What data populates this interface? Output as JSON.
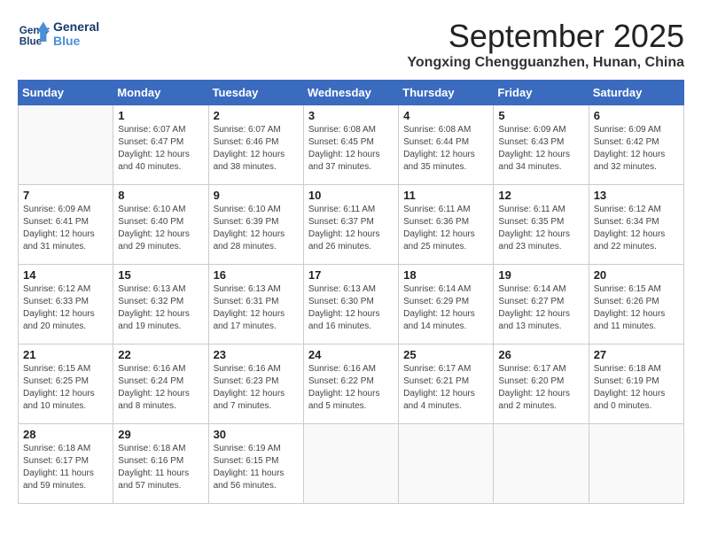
{
  "header": {
    "logo_line1": "General",
    "logo_line2": "Blue",
    "month": "September 2025",
    "location": "Yongxing Chengguanzhen, Hunan, China"
  },
  "weekdays": [
    "Sunday",
    "Monday",
    "Tuesday",
    "Wednesday",
    "Thursday",
    "Friday",
    "Saturday"
  ],
  "weeks": [
    [
      {
        "day": "",
        "info": ""
      },
      {
        "day": "1",
        "info": "Sunrise: 6:07 AM\nSunset: 6:47 PM\nDaylight: 12 hours\nand 40 minutes."
      },
      {
        "day": "2",
        "info": "Sunrise: 6:07 AM\nSunset: 6:46 PM\nDaylight: 12 hours\nand 38 minutes."
      },
      {
        "day": "3",
        "info": "Sunrise: 6:08 AM\nSunset: 6:45 PM\nDaylight: 12 hours\nand 37 minutes."
      },
      {
        "day": "4",
        "info": "Sunrise: 6:08 AM\nSunset: 6:44 PM\nDaylight: 12 hours\nand 35 minutes."
      },
      {
        "day": "5",
        "info": "Sunrise: 6:09 AM\nSunset: 6:43 PM\nDaylight: 12 hours\nand 34 minutes."
      },
      {
        "day": "6",
        "info": "Sunrise: 6:09 AM\nSunset: 6:42 PM\nDaylight: 12 hours\nand 32 minutes."
      }
    ],
    [
      {
        "day": "7",
        "info": "Sunrise: 6:09 AM\nSunset: 6:41 PM\nDaylight: 12 hours\nand 31 minutes."
      },
      {
        "day": "8",
        "info": "Sunrise: 6:10 AM\nSunset: 6:40 PM\nDaylight: 12 hours\nand 29 minutes."
      },
      {
        "day": "9",
        "info": "Sunrise: 6:10 AM\nSunset: 6:39 PM\nDaylight: 12 hours\nand 28 minutes."
      },
      {
        "day": "10",
        "info": "Sunrise: 6:11 AM\nSunset: 6:37 PM\nDaylight: 12 hours\nand 26 minutes."
      },
      {
        "day": "11",
        "info": "Sunrise: 6:11 AM\nSunset: 6:36 PM\nDaylight: 12 hours\nand 25 minutes."
      },
      {
        "day": "12",
        "info": "Sunrise: 6:11 AM\nSunset: 6:35 PM\nDaylight: 12 hours\nand 23 minutes."
      },
      {
        "day": "13",
        "info": "Sunrise: 6:12 AM\nSunset: 6:34 PM\nDaylight: 12 hours\nand 22 minutes."
      }
    ],
    [
      {
        "day": "14",
        "info": "Sunrise: 6:12 AM\nSunset: 6:33 PM\nDaylight: 12 hours\nand 20 minutes."
      },
      {
        "day": "15",
        "info": "Sunrise: 6:13 AM\nSunset: 6:32 PM\nDaylight: 12 hours\nand 19 minutes."
      },
      {
        "day": "16",
        "info": "Sunrise: 6:13 AM\nSunset: 6:31 PM\nDaylight: 12 hours\nand 17 minutes."
      },
      {
        "day": "17",
        "info": "Sunrise: 6:13 AM\nSunset: 6:30 PM\nDaylight: 12 hours\nand 16 minutes."
      },
      {
        "day": "18",
        "info": "Sunrise: 6:14 AM\nSunset: 6:29 PM\nDaylight: 12 hours\nand 14 minutes."
      },
      {
        "day": "19",
        "info": "Sunrise: 6:14 AM\nSunset: 6:27 PM\nDaylight: 12 hours\nand 13 minutes."
      },
      {
        "day": "20",
        "info": "Sunrise: 6:15 AM\nSunset: 6:26 PM\nDaylight: 12 hours\nand 11 minutes."
      }
    ],
    [
      {
        "day": "21",
        "info": "Sunrise: 6:15 AM\nSunset: 6:25 PM\nDaylight: 12 hours\nand 10 minutes."
      },
      {
        "day": "22",
        "info": "Sunrise: 6:16 AM\nSunset: 6:24 PM\nDaylight: 12 hours\nand 8 minutes."
      },
      {
        "day": "23",
        "info": "Sunrise: 6:16 AM\nSunset: 6:23 PM\nDaylight: 12 hours\nand 7 minutes."
      },
      {
        "day": "24",
        "info": "Sunrise: 6:16 AM\nSunset: 6:22 PM\nDaylight: 12 hours\nand 5 minutes."
      },
      {
        "day": "25",
        "info": "Sunrise: 6:17 AM\nSunset: 6:21 PM\nDaylight: 12 hours\nand 4 minutes."
      },
      {
        "day": "26",
        "info": "Sunrise: 6:17 AM\nSunset: 6:20 PM\nDaylight: 12 hours\nand 2 minutes."
      },
      {
        "day": "27",
        "info": "Sunrise: 6:18 AM\nSunset: 6:19 PM\nDaylight: 12 hours\nand 0 minutes."
      }
    ],
    [
      {
        "day": "28",
        "info": "Sunrise: 6:18 AM\nSunset: 6:17 PM\nDaylight: 11 hours\nand 59 minutes."
      },
      {
        "day": "29",
        "info": "Sunrise: 6:18 AM\nSunset: 6:16 PM\nDaylight: 11 hours\nand 57 minutes."
      },
      {
        "day": "30",
        "info": "Sunrise: 6:19 AM\nSunset: 6:15 PM\nDaylight: 11 hours\nand 56 minutes."
      },
      {
        "day": "",
        "info": ""
      },
      {
        "day": "",
        "info": ""
      },
      {
        "day": "",
        "info": ""
      },
      {
        "day": "",
        "info": ""
      }
    ]
  ]
}
